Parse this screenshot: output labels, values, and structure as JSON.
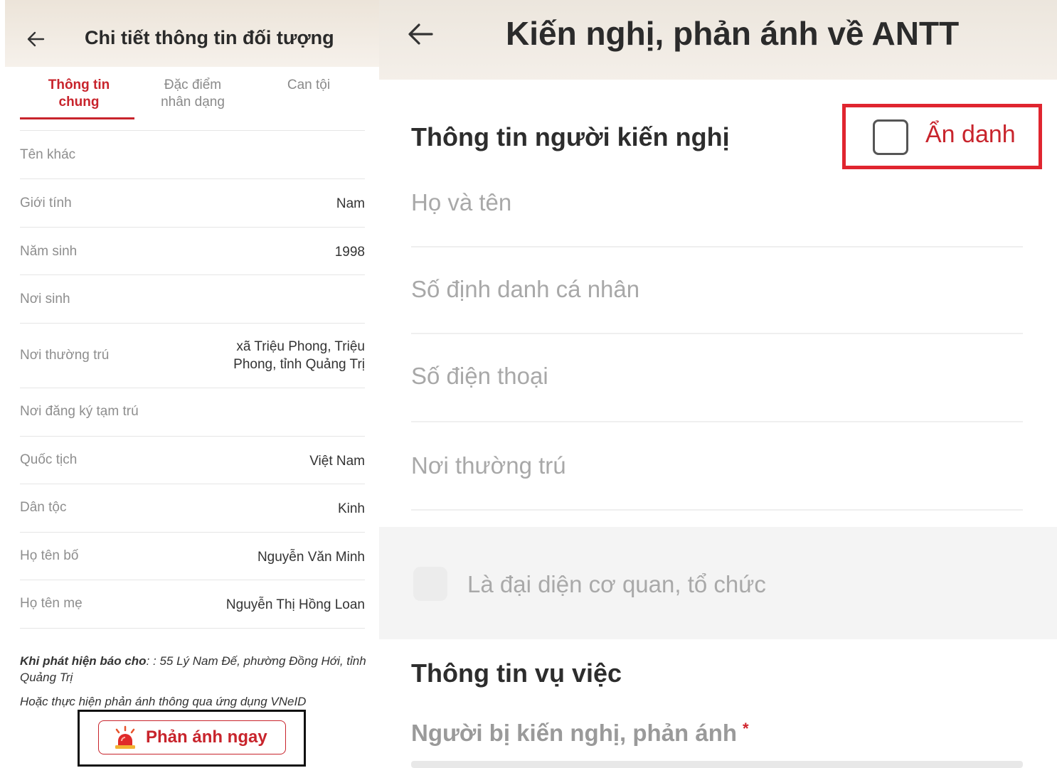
{
  "left": {
    "header": {
      "title": "Chi tiết thông tin đối tượng"
    },
    "tabs": [
      {
        "label": "Thông tin chung",
        "line1": "Thông tin",
        "line2": "chung",
        "active": true
      },
      {
        "label": "Đặc điểm nhân dạng",
        "line1": "Đặc điểm",
        "line2": "nhân dạng",
        "active": false
      },
      {
        "label": "Can tội",
        "line1": "Can tội",
        "line2": "",
        "active": false
      }
    ],
    "rows": [
      {
        "label": "Tên khác",
        "value": ""
      },
      {
        "label": "Giới tính",
        "value": "Nam"
      },
      {
        "label": "Năm sinh",
        "value": "1998"
      },
      {
        "label": "Nơi sinh",
        "value": ""
      },
      {
        "label": "Nơi thường trú",
        "value_line1": "xã Triệu Phong, Triệu",
        "value_line2": "Phong, tỉnh Quảng Trị"
      },
      {
        "label": "Nơi đăng ký tạm trú",
        "value": ""
      },
      {
        "label": "Quốc tịch",
        "value": "Việt Nam"
      },
      {
        "label": "Dân tộc",
        "value": "Kinh"
      },
      {
        "label": "Họ tên bố",
        "value": "Nguyễn Văn Minh"
      },
      {
        "label": "Họ tên mẹ",
        "value": "Nguyễn Thị Hồng Loan"
      }
    ],
    "notice": {
      "bold": "Khi phát hiện báo cho",
      "text": ": : 55 Lý Nam Đế, phường Đồng Hới, tỉnh Quảng Trị",
      "line2": "Hoặc thực hiện phản ánh thông qua ứng dụng VNeID"
    },
    "report_button": {
      "label": "Phản ánh ngay",
      "icon": "siren-icon"
    }
  },
  "right": {
    "header": {
      "title": "Kiến nghị, phản ánh về ANTT"
    },
    "section1_title": "Thông tin người kiến nghị",
    "anonymous": {
      "label": "Ẩn danh",
      "checked": false
    },
    "fields": [
      {
        "placeholder": "Họ và tên"
      },
      {
        "placeholder": "Số định danh cá nhân"
      },
      {
        "placeholder": "Số điện thoại"
      },
      {
        "placeholder": "Nơi thường trú"
      }
    ],
    "org_checkbox": {
      "label": "Là đại diện cơ quan, tổ chức",
      "checked": false
    },
    "section2_title": "Thông tin vụ việc",
    "respondent": {
      "label": "Người bị kiến nghị, phản ánh",
      "required_mark": "*"
    }
  },
  "colors": {
    "accent_red": "#c8242c",
    "highlight_red": "#e0252f",
    "header_beige": "#ece4d9"
  }
}
